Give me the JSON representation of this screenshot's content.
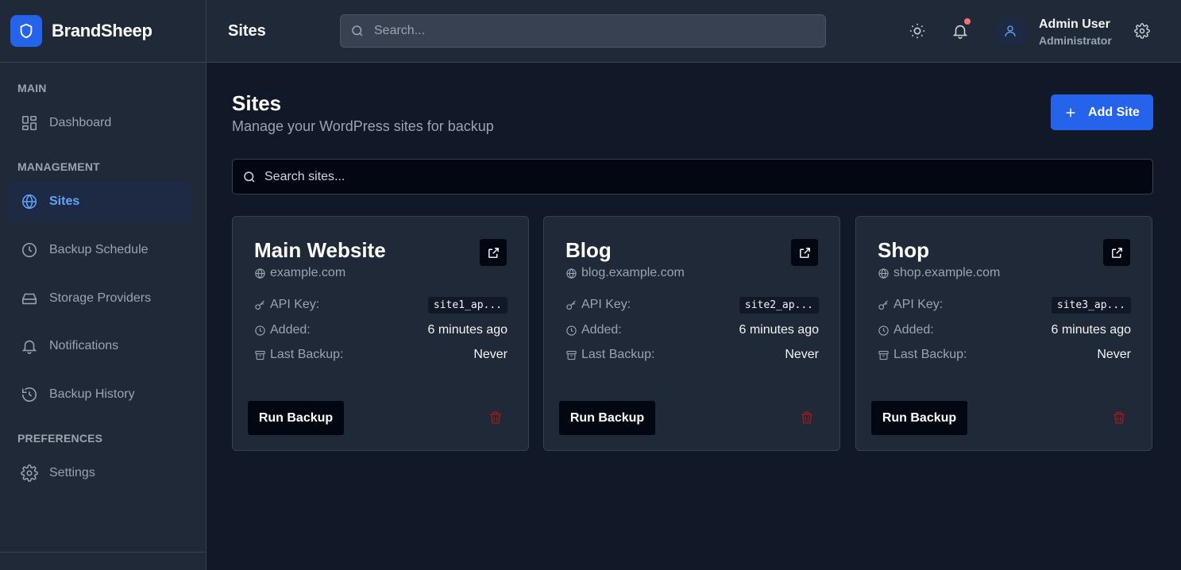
{
  "app": {
    "name": "BrandSheep"
  },
  "sidebar": {
    "sections": [
      {
        "label": "MAIN"
      },
      {
        "label": "MANAGEMENT"
      },
      {
        "label": "PREFERENCES"
      }
    ],
    "items": [
      {
        "label": "Dashboard",
        "icon": "dashboard-icon"
      },
      {
        "label": "Sites",
        "icon": "globe-icon",
        "active": true
      },
      {
        "label": "Backup Schedule",
        "icon": "clock-icon"
      },
      {
        "label": "Storage Providers",
        "icon": "hard-drive-icon"
      },
      {
        "label": "Notifications",
        "icon": "bell-icon"
      },
      {
        "label": "Backup History",
        "icon": "history-icon"
      },
      {
        "label": "Settings",
        "icon": "gear-icon"
      }
    ]
  },
  "header": {
    "title": "Sites",
    "search_placeholder": "Search...",
    "user": {
      "name": "Admin User",
      "role": "Administrator"
    }
  },
  "main": {
    "title": "Sites",
    "subtitle": "Manage your WordPress sites for backup",
    "add_button_label": "Add Site",
    "search_placeholder": "Search sites..."
  },
  "labels": {
    "api_key": "API Key:",
    "added": "Added:",
    "last_backup": "Last Backup:",
    "run_backup": "Run Backup"
  },
  "sites": [
    {
      "name": "Main Website",
      "url": "example.com",
      "api_key": "site1_ap...",
      "added": "6 minutes ago",
      "last_backup": "Never"
    },
    {
      "name": "Blog",
      "url": "blog.example.com",
      "api_key": "site2_ap...",
      "added": "6 minutes ago",
      "last_backup": "Never"
    },
    {
      "name": "Shop",
      "url": "shop.example.com",
      "api_key": "site3_ap...",
      "added": "6 minutes ago",
      "last_backup": "Never"
    }
  ],
  "colors": {
    "background": "#111827",
    "panel": "#1f2937",
    "accent": "#2563eb",
    "active_text": "#60a5fa",
    "danger": "#991b1b",
    "notification_dot": "#f87171"
  }
}
